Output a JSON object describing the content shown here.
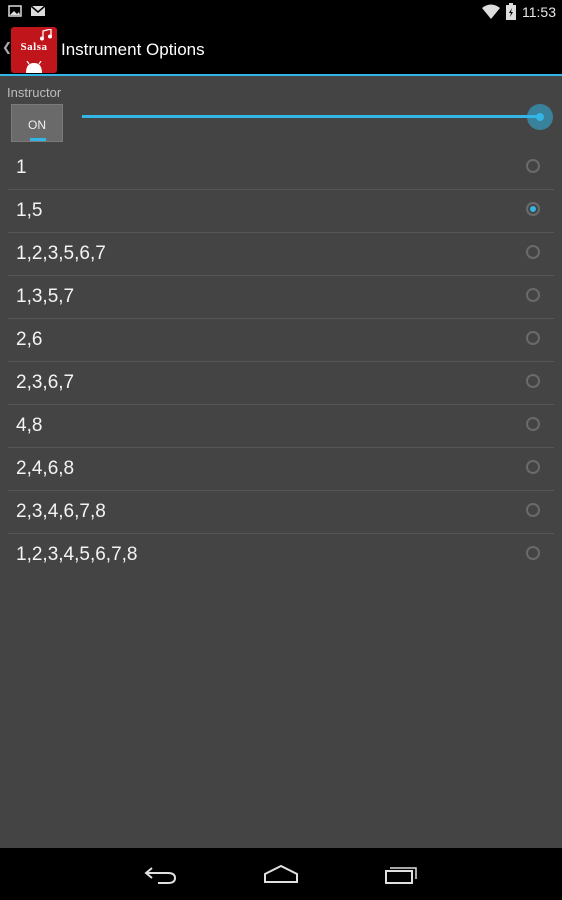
{
  "status_bar": {
    "time": "11:53",
    "left_icons": [
      "picture-icon",
      "mail-icon"
    ],
    "right_icons": [
      "wifi-icon",
      "battery-icon"
    ]
  },
  "action_bar": {
    "app_icon_text": "Salsa",
    "title": "Instrument Options"
  },
  "instructor": {
    "label": "Instructor",
    "toggle_text": "ON",
    "slider_level": 1.0
  },
  "options": [
    {
      "label": "1",
      "selected": false
    },
    {
      "label": "1,5",
      "selected": true
    },
    {
      "label": "1,2,3,5,6,7",
      "selected": false
    },
    {
      "label": "1,3,5,7",
      "selected": false
    },
    {
      "label": "2,6",
      "selected": false
    },
    {
      "label": "2,3,6,7",
      "selected": false
    },
    {
      "label": "4,8",
      "selected": false
    },
    {
      "label": "2,4,6,8",
      "selected": false
    },
    {
      "label": "2,3,4,6,7,8",
      "selected": false
    },
    {
      "label": "1,2,3,4,5,6,7,8",
      "selected": false
    }
  ],
  "nav_bar": {
    "buttons": [
      "back-icon",
      "home-icon",
      "recent-apps-icon"
    ]
  },
  "colors": {
    "accent": "#33b5e5",
    "background": "#444444",
    "app_icon": "#c0161b"
  }
}
